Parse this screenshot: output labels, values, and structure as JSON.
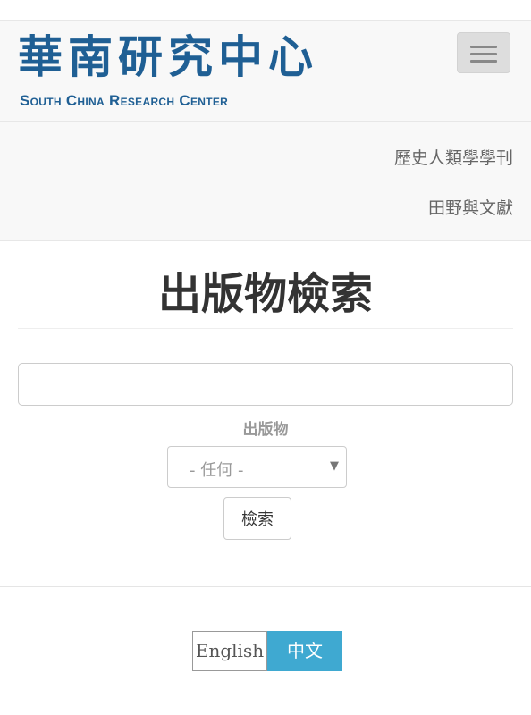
{
  "header": {
    "logo_cn": "華南研究中心",
    "logo_en": "South China Research Center",
    "menu_toggle_icon": "hamburger-menu-icon"
  },
  "nav": {
    "items": [
      {
        "label": "歷史人類學學刊"
      },
      {
        "label": "田野與文獻"
      }
    ]
  },
  "main": {
    "title": "出版物檢索",
    "search": {
      "value": "",
      "placeholder": ""
    },
    "filter": {
      "label": "出版物",
      "selected": "- 任何 -"
    },
    "submit_label": "檢索"
  },
  "language": {
    "options": [
      {
        "label": "English",
        "active": false
      },
      {
        "label": "中文",
        "active": true
      }
    ],
    "active_color": "#3fa9d1"
  },
  "colors": {
    "brand": "#1f5f94",
    "header_bg": "#f8f8f8"
  }
}
